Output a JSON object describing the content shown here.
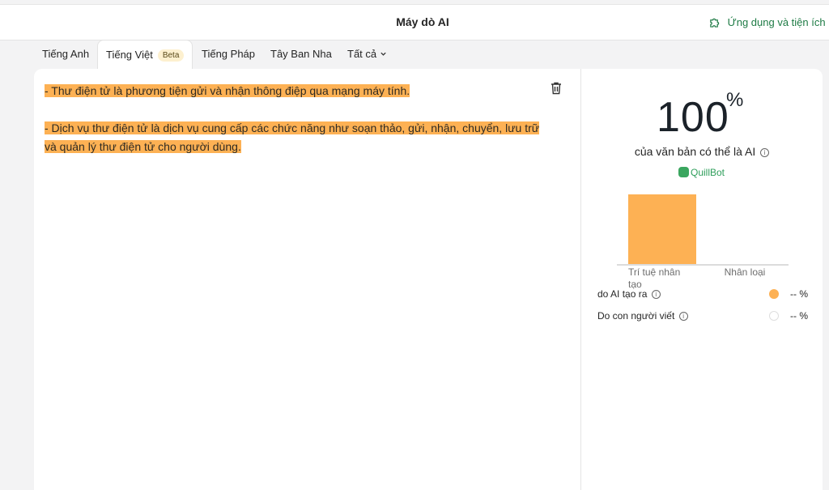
{
  "header": {
    "title": "Máy dò AI",
    "apps_link": "Ứng dụng và tiện ích m"
  },
  "tabs": [
    {
      "label": "Tiếng Anh"
    },
    {
      "label": "Tiếng Việt",
      "badge": "Beta",
      "active": true
    },
    {
      "label": "Tiếng Pháp"
    },
    {
      "label": "Tây Ban Nha"
    },
    {
      "label": "Tất cả"
    }
  ],
  "editor": {
    "paragraphs": [
      "- Thư điện tử là phương tiện gửi và nhận thông điệp qua mạng máy tính.",
      "- Dịch vụ thư điện tử là dịch vụ cung cấp các chức năng như soạn thảo, gửi, nhận, chuyển, lưu trữ và quản lý thư điện tử cho người dùng."
    ],
    "highlight_color": "#fdb154"
  },
  "result": {
    "score": "100",
    "score_unit": "%",
    "description": "của văn bản có thể là AI",
    "brand": "QuillBot",
    "legend": [
      {
        "label": "do AI tạo ra",
        "value": "-- %",
        "color": "#fdb154"
      },
      {
        "label": "Do con người viết",
        "value": "-- %",
        "color": "#ffffff"
      }
    ]
  },
  "chart_data": {
    "type": "bar",
    "categories": [
      "Trí tuệ nhân tạo",
      "Nhân loại"
    ],
    "values": [
      100,
      0
    ],
    "ylim": [
      0,
      100
    ],
    "colors": [
      "#fdb154",
      "#fdb154"
    ]
  },
  "colors": {
    "accent_green": "#1e7b45",
    "highlight": "#fdb154"
  }
}
